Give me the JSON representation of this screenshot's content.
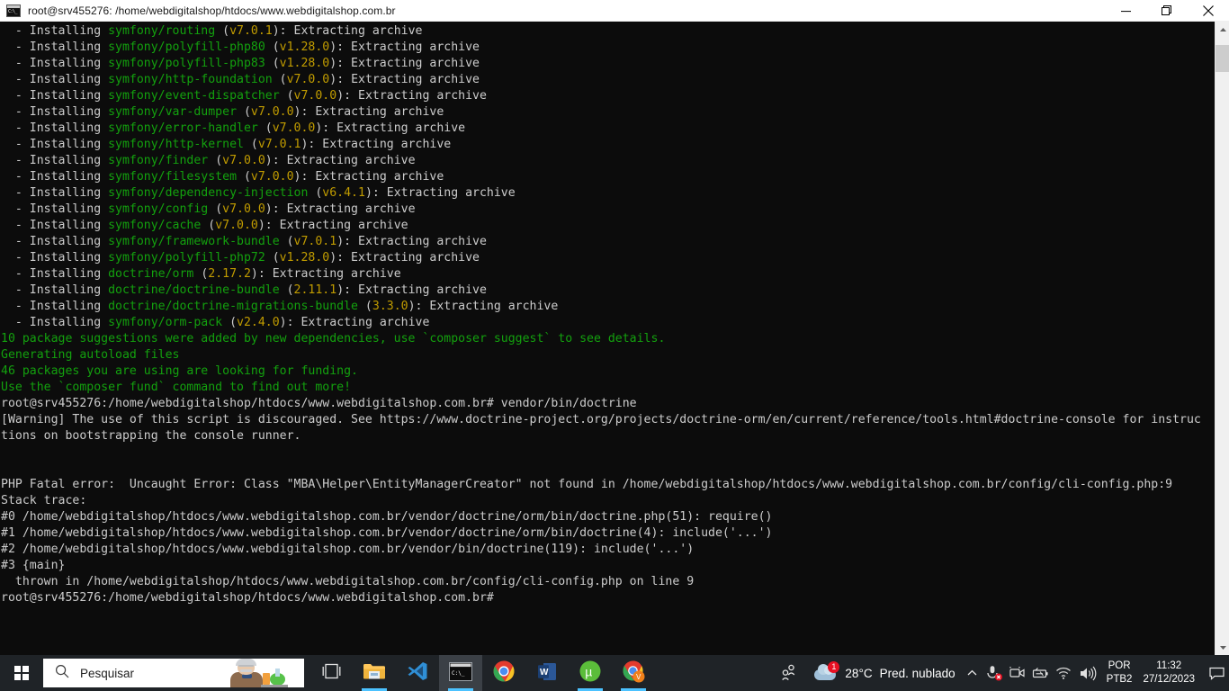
{
  "window": {
    "title": "root@srv455276: /home/webdigitalshop/htdocs/www.webdigitalshop.com.br",
    "icon": "console-icon",
    "minimize_label": "Minimizar",
    "restore_label": "Restaurar",
    "close_label": "Fechar"
  },
  "colors": {
    "terminal_bg": "#0c0c0c",
    "text_default": "#cccccc",
    "text_package": "#13a10e",
    "text_version": "#c19c00",
    "text_green": "#13a10e",
    "taskbar_bg": "#1f2327",
    "accent": "#4cc2ff",
    "badge_red": "#e81123"
  },
  "terminal": {
    "lines": [
      [
        {
          "t": "  - Installing ",
          "c": "def"
        },
        {
          "t": "symfony/routing",
          "c": "pkg"
        },
        {
          "t": " (",
          "c": "def"
        },
        {
          "t": "v7.0.1",
          "c": "ver"
        },
        {
          "t": "): Extracting archive",
          "c": "def"
        }
      ],
      [
        {
          "t": "  - Installing ",
          "c": "def"
        },
        {
          "t": "symfony/polyfill-php80",
          "c": "pkg"
        },
        {
          "t": " (",
          "c": "def"
        },
        {
          "t": "v1.28.0",
          "c": "ver"
        },
        {
          "t": "): Extracting archive",
          "c": "def"
        }
      ],
      [
        {
          "t": "  - Installing ",
          "c": "def"
        },
        {
          "t": "symfony/polyfill-php83",
          "c": "pkg"
        },
        {
          "t": " (",
          "c": "def"
        },
        {
          "t": "v1.28.0",
          "c": "ver"
        },
        {
          "t": "): Extracting archive",
          "c": "def"
        }
      ],
      [
        {
          "t": "  - Installing ",
          "c": "def"
        },
        {
          "t": "symfony/http-foundation",
          "c": "pkg"
        },
        {
          "t": " (",
          "c": "def"
        },
        {
          "t": "v7.0.0",
          "c": "ver"
        },
        {
          "t": "): Extracting archive",
          "c": "def"
        }
      ],
      [
        {
          "t": "  - Installing ",
          "c": "def"
        },
        {
          "t": "symfony/event-dispatcher",
          "c": "pkg"
        },
        {
          "t": " (",
          "c": "def"
        },
        {
          "t": "v7.0.0",
          "c": "ver"
        },
        {
          "t": "): Extracting archive",
          "c": "def"
        }
      ],
      [
        {
          "t": "  - Installing ",
          "c": "def"
        },
        {
          "t": "symfony/var-dumper",
          "c": "pkg"
        },
        {
          "t": " (",
          "c": "def"
        },
        {
          "t": "v7.0.0",
          "c": "ver"
        },
        {
          "t": "): Extracting archive",
          "c": "def"
        }
      ],
      [
        {
          "t": "  - Installing ",
          "c": "def"
        },
        {
          "t": "symfony/error-handler",
          "c": "pkg"
        },
        {
          "t": " (",
          "c": "def"
        },
        {
          "t": "v7.0.0",
          "c": "ver"
        },
        {
          "t": "): Extracting archive",
          "c": "def"
        }
      ],
      [
        {
          "t": "  - Installing ",
          "c": "def"
        },
        {
          "t": "symfony/http-kernel",
          "c": "pkg"
        },
        {
          "t": " (",
          "c": "def"
        },
        {
          "t": "v7.0.1",
          "c": "ver"
        },
        {
          "t": "): Extracting archive",
          "c": "def"
        }
      ],
      [
        {
          "t": "  - Installing ",
          "c": "def"
        },
        {
          "t": "symfony/finder",
          "c": "pkg"
        },
        {
          "t": " (",
          "c": "def"
        },
        {
          "t": "v7.0.0",
          "c": "ver"
        },
        {
          "t": "): Extracting archive",
          "c": "def"
        }
      ],
      [
        {
          "t": "  - Installing ",
          "c": "def"
        },
        {
          "t": "symfony/filesystem",
          "c": "pkg"
        },
        {
          "t": " (",
          "c": "def"
        },
        {
          "t": "v7.0.0",
          "c": "ver"
        },
        {
          "t": "): Extracting archive",
          "c": "def"
        }
      ],
      [
        {
          "t": "  - Installing ",
          "c": "def"
        },
        {
          "t": "symfony/dependency-injection",
          "c": "pkg"
        },
        {
          "t": " (",
          "c": "def"
        },
        {
          "t": "v6.4.1",
          "c": "ver"
        },
        {
          "t": "): Extracting archive",
          "c": "def"
        }
      ],
      [
        {
          "t": "  - Installing ",
          "c": "def"
        },
        {
          "t": "symfony/config",
          "c": "pkg"
        },
        {
          "t": " (",
          "c": "def"
        },
        {
          "t": "v7.0.0",
          "c": "ver"
        },
        {
          "t": "): Extracting archive",
          "c": "def"
        }
      ],
      [
        {
          "t": "  - Installing ",
          "c": "def"
        },
        {
          "t": "symfony/cache",
          "c": "pkg"
        },
        {
          "t": " (",
          "c": "def"
        },
        {
          "t": "v7.0.0",
          "c": "ver"
        },
        {
          "t": "): Extracting archive",
          "c": "def"
        }
      ],
      [
        {
          "t": "  - Installing ",
          "c": "def"
        },
        {
          "t": "symfony/framework-bundle",
          "c": "pkg"
        },
        {
          "t": " (",
          "c": "def"
        },
        {
          "t": "v7.0.1",
          "c": "ver"
        },
        {
          "t": "): Extracting archive",
          "c": "def"
        }
      ],
      [
        {
          "t": "  - Installing ",
          "c": "def"
        },
        {
          "t": "symfony/polyfill-php72",
          "c": "pkg"
        },
        {
          "t": " (",
          "c": "def"
        },
        {
          "t": "v1.28.0",
          "c": "ver"
        },
        {
          "t": "): Extracting archive",
          "c": "def"
        }
      ],
      [
        {
          "t": "  - Installing ",
          "c": "def"
        },
        {
          "t": "doctrine/orm",
          "c": "pkg"
        },
        {
          "t": " (",
          "c": "def"
        },
        {
          "t": "2.17.2",
          "c": "ver"
        },
        {
          "t": "): Extracting archive",
          "c": "def"
        }
      ],
      [
        {
          "t": "  - Installing ",
          "c": "def"
        },
        {
          "t": "doctrine/doctrine-bundle",
          "c": "pkg"
        },
        {
          "t": " (",
          "c": "def"
        },
        {
          "t": "2.11.1",
          "c": "ver"
        },
        {
          "t": "): Extracting archive",
          "c": "def"
        }
      ],
      [
        {
          "t": "  - Installing ",
          "c": "def"
        },
        {
          "t": "doctrine/doctrine-migrations-bundle",
          "c": "pkg"
        },
        {
          "t": " (",
          "c": "def"
        },
        {
          "t": "3.3.0",
          "c": "ver"
        },
        {
          "t": "): Extracting archive",
          "c": "def"
        }
      ],
      [
        {
          "t": "  - Installing ",
          "c": "def"
        },
        {
          "t": "symfony/orm-pack",
          "c": "pkg"
        },
        {
          "t": " (",
          "c": "def"
        },
        {
          "t": "v2.4.0",
          "c": "ver"
        },
        {
          "t": "): Extracting archive",
          "c": "def"
        }
      ],
      [
        {
          "t": "10 package suggestions were added by new dependencies, use `composer suggest` to see details.",
          "c": "green"
        }
      ],
      [
        {
          "t": "Generating autoload files",
          "c": "green"
        }
      ],
      [
        {
          "t": "46 packages you are using are looking for funding.",
          "c": "green"
        }
      ],
      [
        {
          "t": "Use the `composer fund` command to find out more!",
          "c": "green"
        }
      ],
      [
        {
          "t": "root@srv455276:/home/webdigitalshop/htdocs/www.webdigitalshop.com.br# vendor/bin/doctrine",
          "c": "def"
        }
      ],
      [
        {
          "t": "[Warning] The use of this script is discouraged. See https://www.doctrine-project.org/projects/doctrine-orm/en/current/reference/tools.html#doctrine-console for instruc",
          "c": "def"
        }
      ],
      [
        {
          "t": "tions on bootstrapping the console runner.",
          "c": "def"
        }
      ],
      [
        {
          "t": "",
          "c": "def"
        }
      ],
      [
        {
          "t": "",
          "c": "def"
        }
      ],
      [
        {
          "t": "PHP Fatal error:  Uncaught Error: Class \"MBA\\Helper\\EntityManagerCreator\" not found in /home/webdigitalshop/htdocs/www.webdigitalshop.com.br/config/cli-config.php:9",
          "c": "def"
        }
      ],
      [
        {
          "t": "Stack trace:",
          "c": "def"
        }
      ],
      [
        {
          "t": "#0 /home/webdigitalshop/htdocs/www.webdigitalshop.com.br/vendor/doctrine/orm/bin/doctrine.php(51): require()",
          "c": "def"
        }
      ],
      [
        {
          "t": "#1 /home/webdigitalshop/htdocs/www.webdigitalshop.com.br/vendor/doctrine/orm/bin/doctrine(4): include('...')",
          "c": "def"
        }
      ],
      [
        {
          "t": "#2 /home/webdigitalshop/htdocs/www.webdigitalshop.com.br/vendor/bin/doctrine(119): include('...')",
          "c": "def"
        }
      ],
      [
        {
          "t": "#3 {main}",
          "c": "def"
        }
      ],
      [
        {
          "t": "  thrown in /home/webdigitalshop/htdocs/www.webdigitalshop.com.br/config/cli-config.php on line 9",
          "c": "def"
        }
      ],
      [
        {
          "t": "root@srv455276:/home/webdigitalshop/htdocs/www.webdigitalshop.com.br#",
          "c": "def"
        }
      ]
    ]
  },
  "scrollbar": {
    "up_label": "Rolar para cima",
    "down_label": "Rolar para baixo"
  },
  "taskbar": {
    "start_label": "Iniciar",
    "search": {
      "placeholder": "Pesquisar",
      "value": "Pesquisar",
      "icon": "search-icon"
    },
    "buttons": [
      {
        "name": "task-view",
        "label": "Visão de Tarefas",
        "icon": "task-view-icon",
        "active": false,
        "open": false
      },
      {
        "name": "file-explorer",
        "label": "Explorador de Arquivos",
        "icon": "folder-icon",
        "active": false,
        "open": true
      },
      {
        "name": "vs-code",
        "label": "Visual Studio Code",
        "icon": "vscode-icon",
        "active": false,
        "open": false
      },
      {
        "name": "terminal",
        "label": "Prompt de Comando",
        "icon": "console-icon",
        "active": true,
        "open": true
      },
      {
        "name": "google-chrome",
        "label": "Google Chrome",
        "icon": "chrome-icon",
        "active": false,
        "open": false
      },
      {
        "name": "microsoft-word",
        "label": "Microsoft Word",
        "icon": "word-icon",
        "active": false,
        "open": false
      },
      {
        "name": "utorrent",
        "label": "uTorrent",
        "icon": "utorrent-icon",
        "active": false,
        "open": true
      },
      {
        "name": "chrome-profile",
        "label": "Chrome (Perfil V)",
        "icon": "chrome-profile-icon",
        "active": false,
        "open": true
      }
    ],
    "tray": {
      "people_label": "Reunir-se agora",
      "weather": {
        "temperature": "28°C",
        "condition": "Pred. nublado",
        "badge": "1",
        "icon": "cloud-icon"
      },
      "overflow_label": "Mostrar ícones ocultos",
      "icons": [
        {
          "name": "mic-muted-icon",
          "label": "Microfone silenciado"
        },
        {
          "name": "camera-icon",
          "label": "Câmera"
        },
        {
          "name": "battery-icon",
          "label": "Bateria"
        },
        {
          "name": "network-icon",
          "label": "Rede Wi-Fi"
        },
        {
          "name": "volume-icon",
          "label": "Volume"
        }
      ],
      "language": {
        "line1": "POR",
        "line2": "PTB2"
      },
      "clock": {
        "time": "11:32",
        "date": "27/12/2023"
      },
      "action_center_label": "Central de Ações"
    }
  }
}
